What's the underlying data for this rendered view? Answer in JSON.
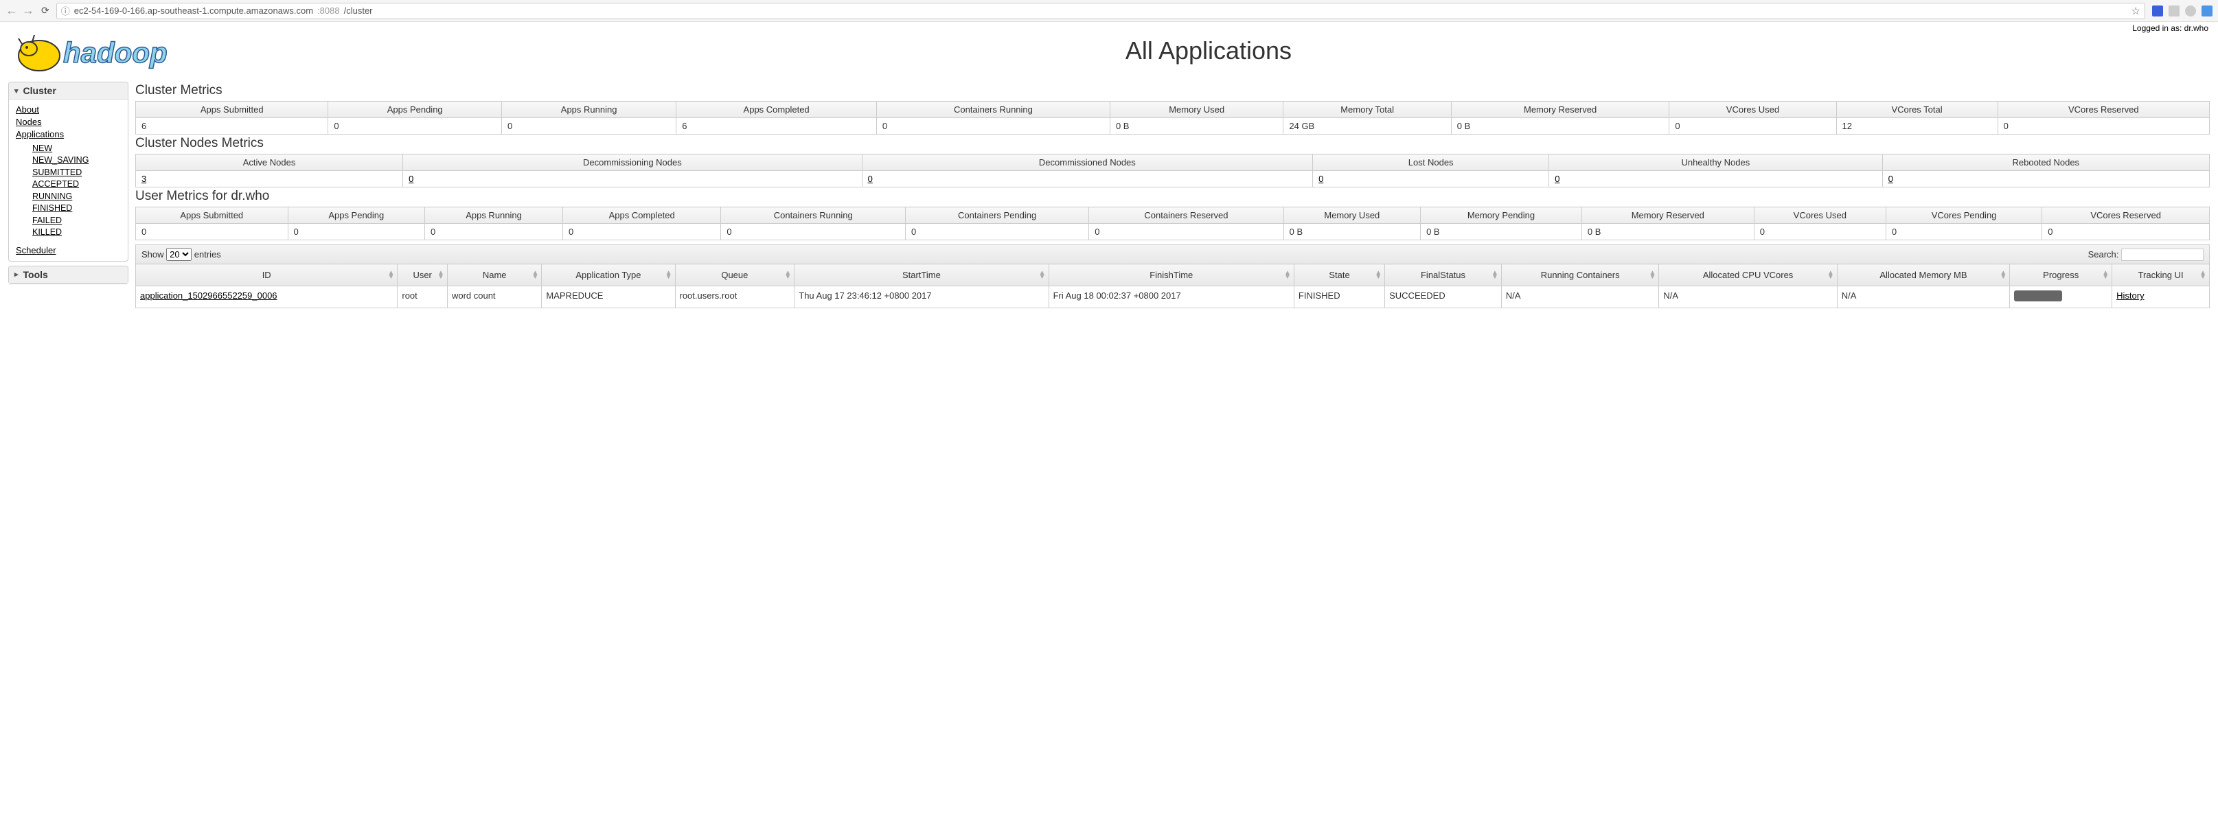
{
  "browser": {
    "url_host": "ec2-54-169-0-166.ap-southeast-1.compute.amazonaws.com",
    "url_port": ":8088",
    "url_path": "/cluster"
  },
  "header": {
    "page_title": "All Applications",
    "logged_in": "Logged in as: dr.who"
  },
  "sidebar": {
    "cluster_label": "Cluster",
    "tools_label": "Tools",
    "about": "About",
    "nodes": "Nodes",
    "applications": "Applications",
    "scheduler": "Scheduler",
    "states": [
      "NEW",
      "NEW_SAVING",
      "SUBMITTED",
      "ACCEPTED",
      "RUNNING",
      "FINISHED",
      "FAILED",
      "KILLED"
    ]
  },
  "cluster_metrics": {
    "title": "Cluster Metrics",
    "headers": [
      "Apps Submitted",
      "Apps Pending",
      "Apps Running",
      "Apps Completed",
      "Containers Running",
      "Memory Used",
      "Memory Total",
      "Memory Reserved",
      "VCores Used",
      "VCores Total",
      "VCores Reserved"
    ],
    "values": [
      "6",
      "0",
      "0",
      "6",
      "0",
      "0 B",
      "24 GB",
      "0 B",
      "0",
      "12",
      "0"
    ]
  },
  "nodes_metrics": {
    "title": "Cluster Nodes Metrics",
    "headers": [
      "Active Nodes",
      "Decommissioning Nodes",
      "Decommissioned Nodes",
      "Lost Nodes",
      "Unhealthy Nodes",
      "Rebooted Nodes"
    ],
    "values": [
      "3",
      "0",
      "0",
      "0",
      "0",
      "0"
    ]
  },
  "user_metrics": {
    "title": "User Metrics for dr.who",
    "headers": [
      "Apps Submitted",
      "Apps Pending",
      "Apps Running",
      "Apps Completed",
      "Containers Running",
      "Containers Pending",
      "Containers Reserved",
      "Memory Used",
      "Memory Pending",
      "Memory Reserved",
      "VCores Used",
      "VCores Pending",
      "VCores Reserved"
    ],
    "values": [
      "0",
      "0",
      "0",
      "0",
      "0",
      "0",
      "0",
      "0 B",
      "0 B",
      "0 B",
      "0",
      "0",
      "0"
    ]
  },
  "datatable": {
    "show_label": "Show",
    "entries_label": "entries",
    "page_size": "20",
    "search_label": "Search:",
    "columns": [
      "ID",
      "User",
      "Name",
      "Application Type",
      "Queue",
      "StartTime",
      "FinishTime",
      "State",
      "FinalStatus",
      "Running Containers",
      "Allocated CPU VCores",
      "Allocated Memory MB",
      "Progress",
      "Tracking UI"
    ],
    "rows": [
      {
        "id": "application_1502966552259_0006",
        "user": "root",
        "name": "word count",
        "apptype": "MAPREDUCE",
        "queue": "root.users.root",
        "start": "Thu Aug 17 23:46:12 +0800 2017",
        "finish": "Fri Aug 18 00:02:37 +0800 2017",
        "state": "FINISHED",
        "finalstatus": "SUCCEEDED",
        "running_containers": "N/A",
        "alloc_vcores": "N/A",
        "alloc_mem": "N/A",
        "tracking": "History"
      }
    ]
  }
}
